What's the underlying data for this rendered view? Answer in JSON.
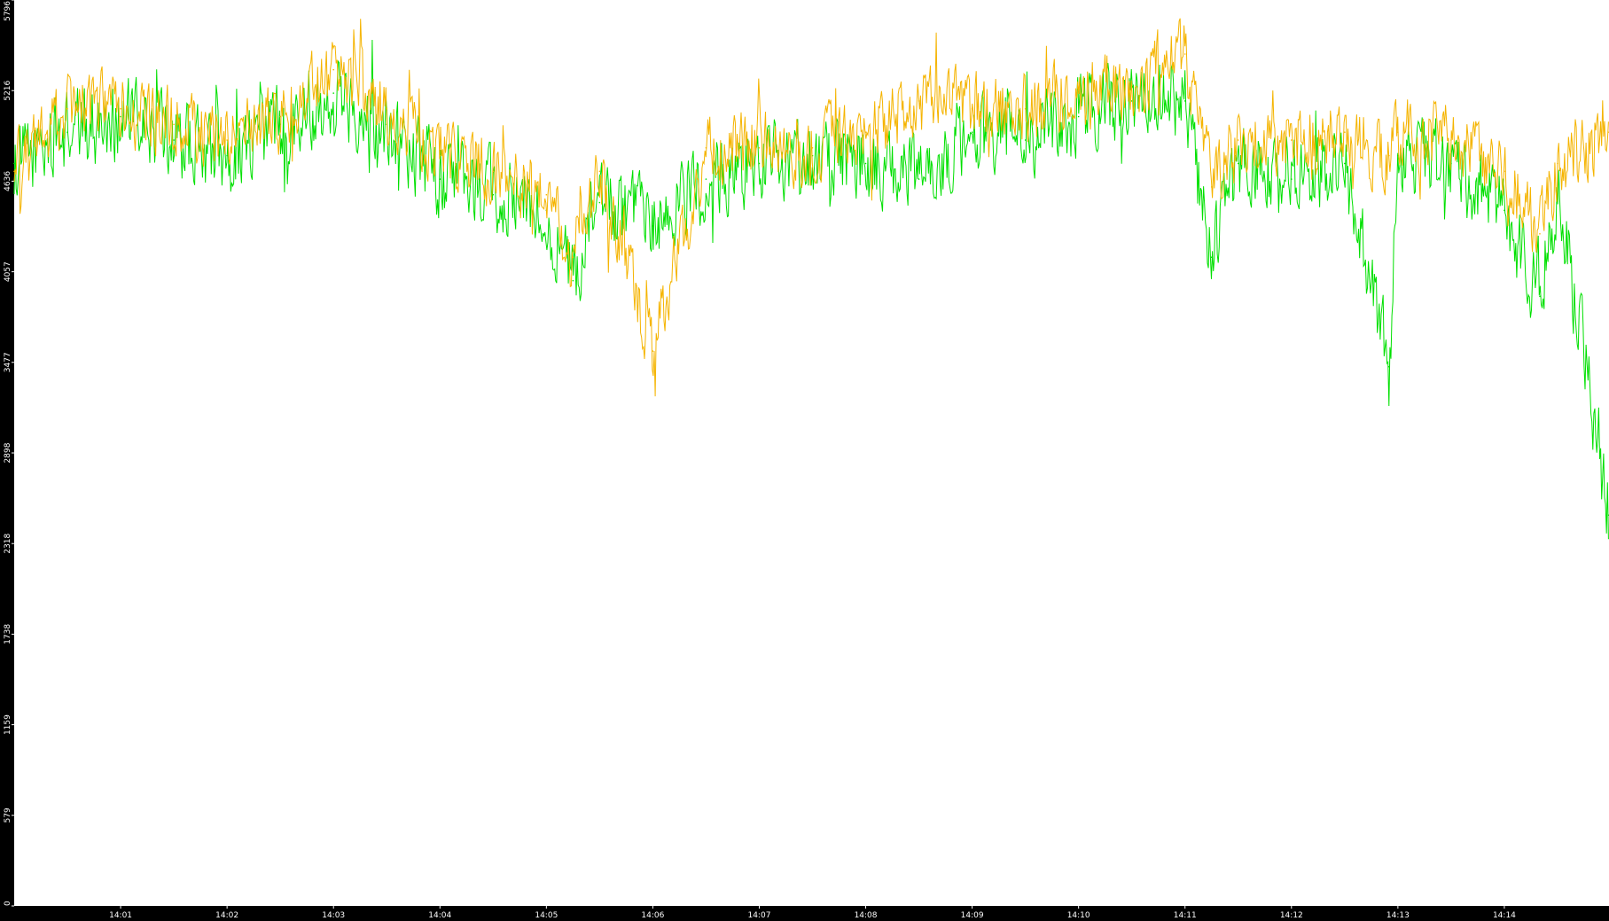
{
  "colors": {
    "background": "#ffffff",
    "axis_background": "#000000",
    "axis_text": "#ffffff",
    "series_green": "#00e000",
    "series_orange": "#f5b400"
  },
  "chart_data": {
    "type": "line",
    "title": "",
    "xlabel": "",
    "ylabel": "",
    "grid": false,
    "legend": "none",
    "ylim": [
      0,
      5796
    ],
    "xlim": [
      "14:00:00",
      "14:14:59"
    ],
    "x_tick_labels": [
      "14:01",
      "14:02",
      "14:03",
      "14:04",
      "14:05",
      "14:06",
      "14:07",
      "14:08",
      "14:09",
      "14:10",
      "14:11",
      "14:12",
      "14:13",
      "14:14"
    ],
    "y_tick_labels": [
      "0",
      "579",
      "1159",
      "1738",
      "2318",
      "2898",
      "3477",
      "4057",
      "4636",
      "5216",
      "5796"
    ],
    "series": [
      {
        "color": "#00e000",
        "x": [
          "14:00:00",
          "14:00:30",
          "14:01:00",
          "14:01:30",
          "14:02:00",
          "14:02:30",
          "14:03:00",
          "14:03:30",
          "14:04:00",
          "14:04:30",
          "14:05:00",
          "14:05:15",
          "14:05:30",
          "14:06:00",
          "14:06:30",
          "14:07:00",
          "14:07:30",
          "14:08:00",
          "14:08:30",
          "14:09:00",
          "14:09:30",
          "14:10:00",
          "14:10:30",
          "14:11:00",
          "14:11:15",
          "14:11:30",
          "14:12:00",
          "14:12:30",
          "14:12:55",
          "14:13:00",
          "14:13:30",
          "14:14:00",
          "14:14:20",
          "14:14:30",
          "14:14:59"
        ],
        "y": [
          4750,
          4950,
          5050,
          4900,
          4800,
          5000,
          5200,
          5000,
          4650,
          4550,
          4450,
          4000,
          4500,
          4350,
          4650,
          4750,
          4800,
          4750,
          4650,
          4950,
          4900,
          5050,
          5150,
          5150,
          4150,
          4750,
          4650,
          4750,
          3450,
          4800,
          4750,
          4450,
          3900,
          4550,
          2500
        ]
      },
      {
        "color": "#f5b400",
        "x": [
          "14:00:00",
          "14:00:30",
          "14:01:00",
          "14:01:30",
          "14:02:00",
          "14:02:30",
          "14:03:00",
          "14:03:30",
          "14:04:00",
          "14:04:30",
          "14:05:00",
          "14:05:15",
          "14:05:30",
          "14:06:00",
          "14:06:30",
          "14:07:00",
          "14:07:30",
          "14:08:00",
          "14:08:30",
          "14:09:00",
          "14:09:30",
          "14:10:00",
          "14:10:30",
          "14:11:00",
          "14:11:15",
          "14:11:30",
          "14:12:00",
          "14:12:30",
          "14:12:55",
          "14:13:00",
          "14:13:30",
          "14:14:00",
          "14:14:20",
          "14:14:30",
          "14:14:59"
        ],
        "y": [
          4700,
          5100,
          5100,
          5000,
          4900,
          5050,
          5350,
          5100,
          4800,
          4700,
          4550,
          4150,
          4700,
          3550,
          4850,
          4850,
          4850,
          4950,
          5150,
          5100,
          5100,
          5200,
          5250,
          5450,
          4600,
          4900,
          4900,
          4950,
          4800,
          4950,
          4900,
          4700,
          4300,
          4750,
          4950
        ]
      }
    ]
  }
}
